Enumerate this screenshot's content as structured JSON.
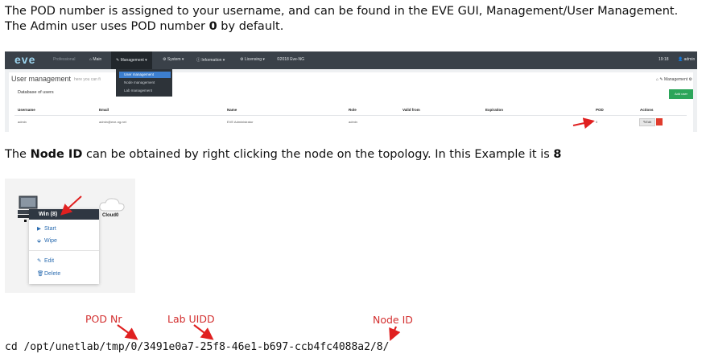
{
  "intro": {
    "pod_text_before": "The POD number is assigned to your username, and can be found in the EVE GUI, Management/User Management. The Admin user uses POD number ",
    "pod_value": "0",
    "pod_text_after": " by default."
  },
  "eve_gui": {
    "logo": "eve",
    "edition": "Professional",
    "nav": [
      "Main",
      "Management",
      "System",
      "Information",
      "Licensing",
      "©2018 Eve-NG"
    ],
    "nav_right": [
      "19:18",
      "admin"
    ],
    "dropdown": [
      "User management",
      "Node management",
      "Lab management"
    ],
    "page_title": "User management",
    "page_subtitle": "here you can fi",
    "breadcrumb": "Management",
    "panel_title": "Database of users",
    "add_button": "Add user",
    "columns": [
      "Username",
      "Email",
      "Name",
      "Role",
      "Valid from",
      "Expiration",
      "POD",
      "Actions"
    ],
    "row": {
      "username": "admin",
      "email": "admin@eve-ng.net",
      "name": "EVE Administrator",
      "role": "admin",
      "valid_from": "",
      "expiration": "",
      "pod": "0",
      "edit": "Edit"
    }
  },
  "node_para": {
    "text_before": "The ",
    "bold": "Node ID",
    "text_mid": " can be obtained by right clicking the node on the topology. In this Example it is ",
    "value": "8"
  },
  "topology": {
    "menu_title": "Win (8)",
    "menu_items": [
      "Start",
      "Wipe",
      "Edit",
      "Delete"
    ],
    "cloud_label": "Cloud0",
    "icons": [
      "pc-icon",
      "cloud-icon",
      "play-icon",
      "wipe-icon",
      "edit-icon",
      "trash-icon"
    ]
  },
  "labels": {
    "pod": "POD Nr",
    "lab": "Lab UIDD",
    "node": "Node ID"
  },
  "command": "cd /opt/unetlab/tmp/0/3491e0a7-25f8-46e1-b697-ccb4fc4088a2/8/",
  "colors": {
    "annotation_red": "#d32f2f",
    "eve_nav": "#3a4149",
    "eve_green": "#2ca55a",
    "eve_selected": "#3d7fcf"
  }
}
